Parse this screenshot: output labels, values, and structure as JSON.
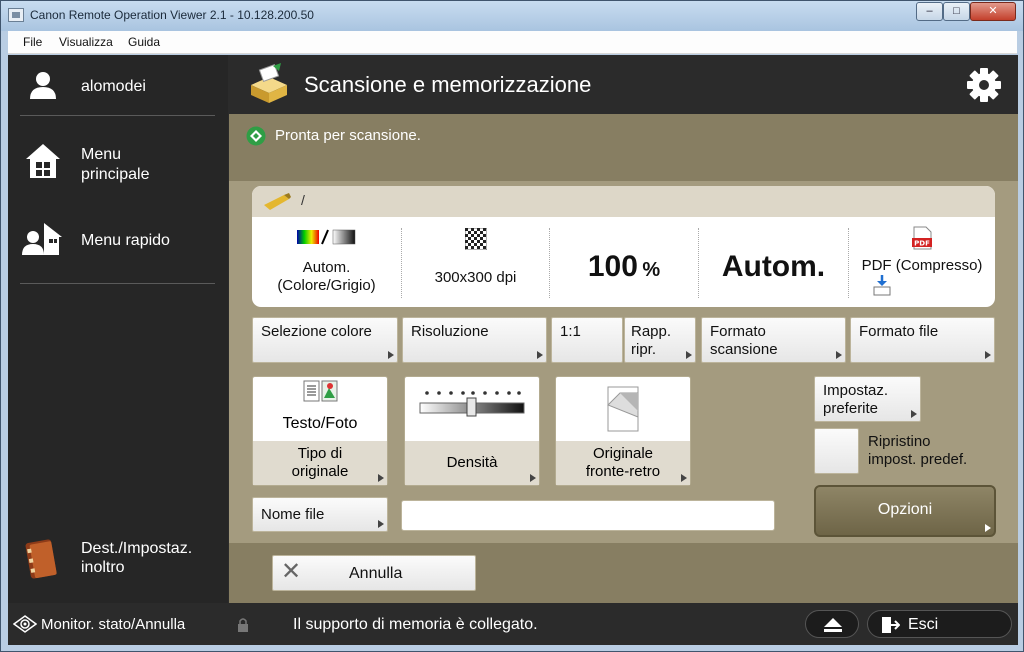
{
  "window": {
    "title": "Canon Remote Operation Viewer 2.1 - 10.128.200.50",
    "min": "–",
    "max": "□",
    "close": "✕"
  },
  "menubar": {
    "file": "File",
    "view": "Visualizza",
    "help": "Guida"
  },
  "sidebar": {
    "user": "alomodei",
    "main_menu_line1": "Menu",
    "main_menu_line2": "principale",
    "quick_menu": "Menu rapido",
    "dest_line1": "Dest./Impostaz.",
    "dest_line2": "inoltro",
    "monitor": "Monitor. stato/Annulla"
  },
  "header": {
    "title": "Scansione e memorizzazione",
    "icons": [
      "scan-store-icon",
      "gear-icon"
    ]
  },
  "status": {
    "message": "Pronta per scansione."
  },
  "panel": {
    "path": "/",
    "color_line1": "Autom.",
    "color_line2": "(Colore/Grigio)",
    "resolution": "300x300 dpi",
    "ratio_value": "100",
    "ratio_unit": "%",
    "size": "Autom.",
    "file_format": "PDF (Compresso)"
  },
  "buttons": {
    "color_select": "Selezione colore",
    "resolution": "Risoluzione",
    "ratio_one": "1:1",
    "ratio_line1": "Rapp.",
    "ratio_line2": "ripr.",
    "scan_size_line1": "Formato",
    "scan_size_line2": "scansione",
    "file_format": "Formato file",
    "orig_type_value": "Testo/Foto",
    "orig_type_line1": "Tipo di",
    "orig_type_line2": "originale",
    "density": "Densità",
    "duplex_line1": "Originale",
    "duplex_line2": "fronte-retro",
    "fav_line1": "Impostaz.",
    "fav_line2": "preferite",
    "reset_line1": "Ripristino",
    "reset_line2": "impost. predef.",
    "options": "Opzioni",
    "file_name": "Nome file",
    "cancel": "Annulla"
  },
  "filename": {
    "value": ""
  },
  "footer": {
    "message": "Il supporto di memoria è collegato.",
    "exit": "Esci"
  },
  "colors": {
    "chrome": "#2b2b2b",
    "status": "#877e62",
    "main": "#a49b7f",
    "accent_green": "#2f9e45"
  }
}
